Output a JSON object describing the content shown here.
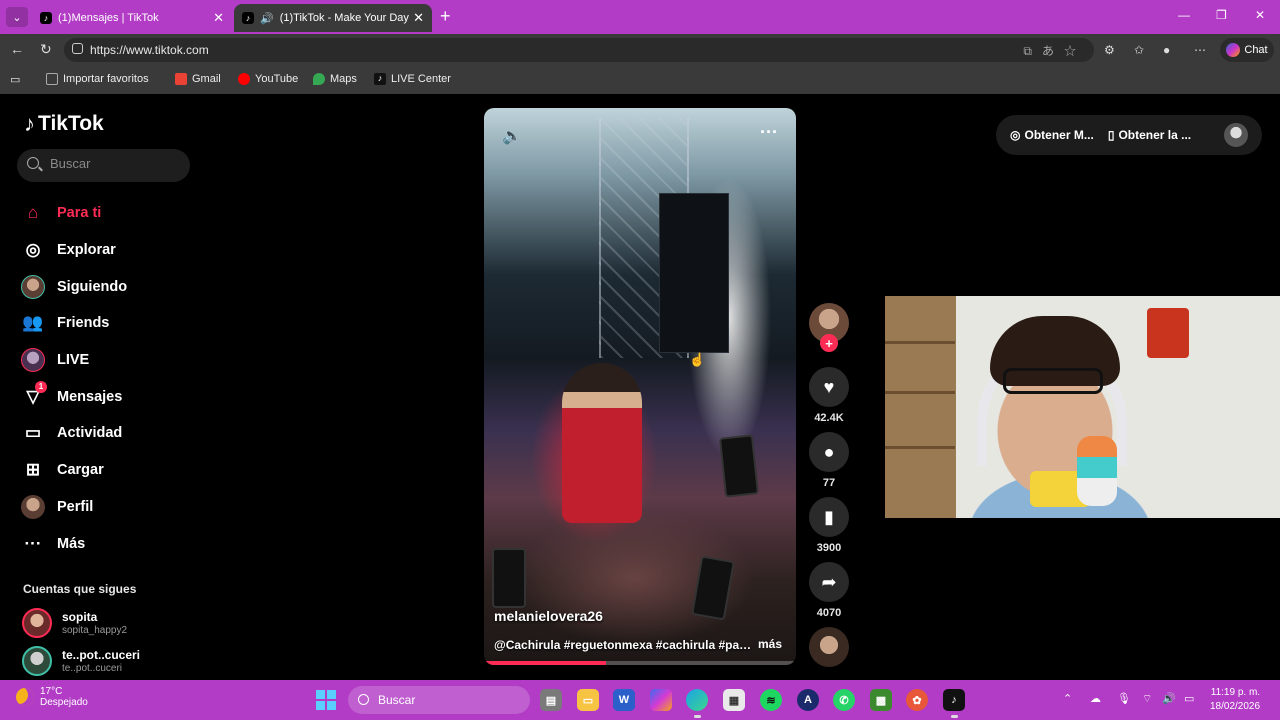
{
  "browser": {
    "tabs": [
      {
        "title": "(1)Mensajes | TikTok",
        "active": false
      },
      {
        "title": "(1)TikTok - Make Your Day",
        "active": true
      }
    ],
    "url": "https://www.tiktok.com",
    "chat_label": "Chat",
    "bookmarks": [
      {
        "label": "Importar favoritos",
        "color": "#aaaaaa"
      },
      {
        "label": "Gmail",
        "color": "#ea4335"
      },
      {
        "label": "YouTube",
        "color": "#ff0000"
      },
      {
        "label": "Maps",
        "color": "#34a853"
      },
      {
        "label": "LIVE Center",
        "color": "#000000"
      }
    ]
  },
  "tiktok": {
    "logo": "TikTok",
    "search_placeholder": "Buscar",
    "nav": [
      {
        "label": "Para ti",
        "icon": "home-icon",
        "active": true
      },
      {
        "label": "Explorar",
        "icon": "compass-icon"
      },
      {
        "label": "Siguiendo",
        "icon": "avatar"
      },
      {
        "label": "Friends",
        "icon": "friends-icon"
      },
      {
        "label": "LIVE",
        "icon": "live-avatar"
      },
      {
        "label": "Mensajes",
        "icon": "send-icon",
        "badge": "1"
      },
      {
        "label": "Actividad",
        "icon": "activity-icon"
      },
      {
        "label": "Cargar",
        "icon": "upload-icon"
      },
      {
        "label": "Perfil",
        "icon": "profile-avatar"
      },
      {
        "label": "Más",
        "icon": "more-icon"
      }
    ],
    "following_title": "Cuentas que sigues",
    "following": [
      {
        "name": "sopita",
        "handle": "sopita_happy2"
      },
      {
        "name": "te..pot..cuceri",
        "handle": "te..pot..cuceri"
      }
    ],
    "top_buttons": [
      "Obtener M...",
      "Obtener la ..."
    ],
    "video": {
      "author": "melanielovera26",
      "caption": "@Cachirula #reguetonmexa #cachirula #party #baile",
      "more_label": "más",
      "progress": 0.39
    },
    "actions": {
      "likes": "42.4K",
      "comments": "77",
      "saves": "3900",
      "shares": "4070"
    }
  },
  "taskbar": {
    "weather_temp": "17°C",
    "weather_desc": "Despejado",
    "search_label": "Buscar",
    "time": "11:19 p. m.",
    "date": "18/02/2026"
  }
}
